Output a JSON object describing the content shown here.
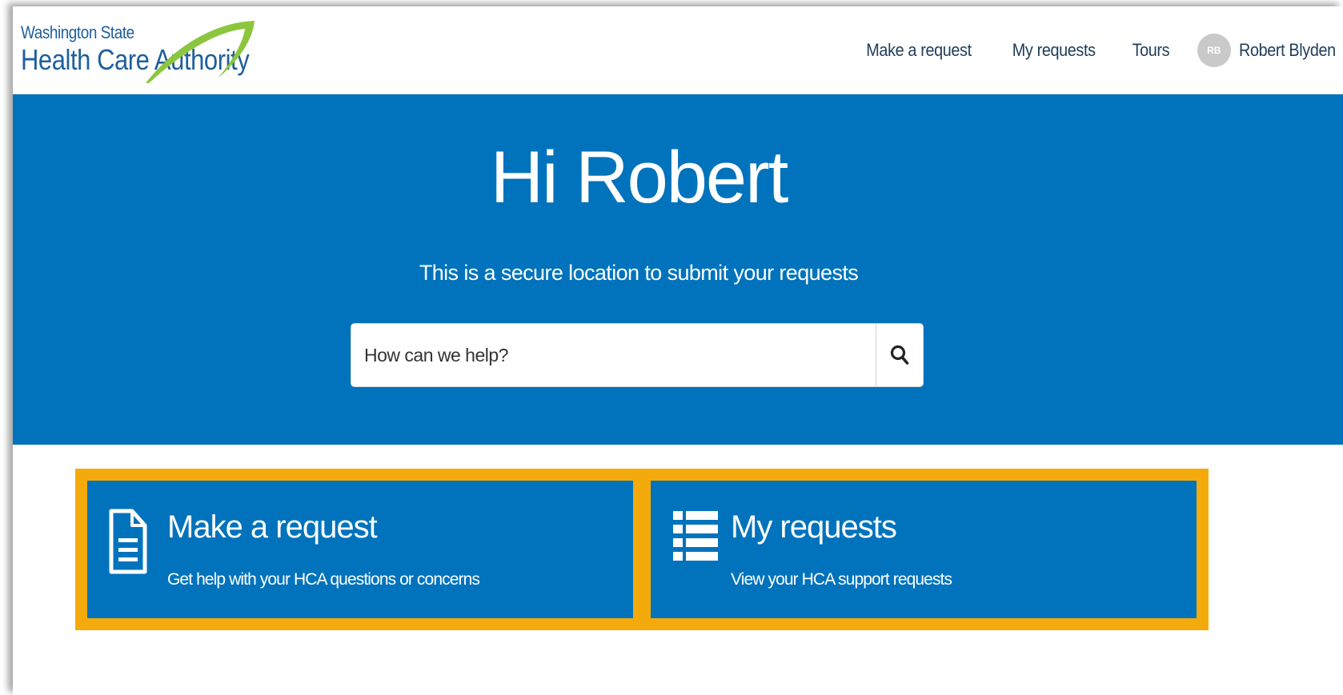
{
  "header": {
    "logo": {
      "line1": "Washington State",
      "line2": "Health Care Authority",
      "swoosh_color": "#8cc63f"
    },
    "nav": {
      "make_request": "Make a request",
      "my_requests": "My requests",
      "tours": "Tours"
    },
    "user": {
      "initials": "RB",
      "name": "Robert Blyden"
    }
  },
  "hero": {
    "greeting": "Hi Robert",
    "subtitle": "This is a secure location to submit your requests",
    "search": {
      "placeholder": "How can we help?",
      "value": "",
      "icon": "search-icon"
    },
    "background": "#0073bc"
  },
  "cards": [
    {
      "icon": "document-icon",
      "title": "Make a request",
      "description": "Get help with your HCA questions or concerns"
    },
    {
      "icon": "list-icon",
      "title": "My requests",
      "description": "View your HCA support requests"
    }
  ],
  "colors": {
    "primary": "#0073bc",
    "highlight": "#f4aa0b",
    "nav_text": "#1e3d5c"
  }
}
